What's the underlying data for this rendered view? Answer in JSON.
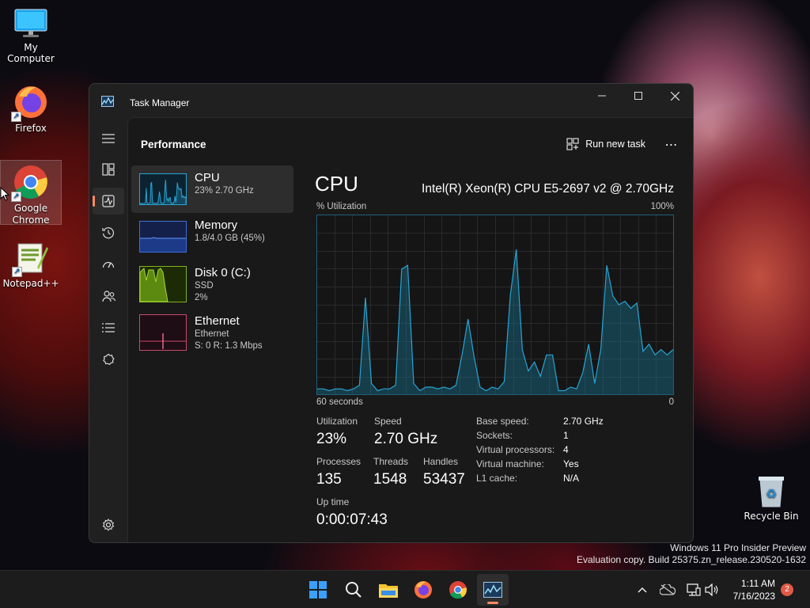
{
  "desktop": {
    "icons": [
      {
        "label": "My Computer"
      },
      {
        "label": "Firefox"
      },
      {
        "label": "Google Chrome"
      },
      {
        "label": "Notepad++"
      },
      {
        "label": "Recycle Bin"
      }
    ],
    "watermark": {
      "line1": "Windows 11 Pro Insider Preview",
      "line2": "Evaluation copy. Build 25375.zn_release.230520-1632"
    }
  },
  "window": {
    "title": "Task Manager",
    "nav_icons": [
      "hamburger-icon",
      "processes-icon",
      "performance-icon",
      "app-history-icon",
      "startup-apps-icon",
      "users-icon",
      "details-icon",
      "services-icon",
      "settings-icon"
    ],
    "page_title": "Performance",
    "run_new_task": "Run new task",
    "more": "⋯"
  },
  "resources": [
    {
      "name": "CPU",
      "sub1": "23%  2.70 GHz",
      "sub2": "",
      "color": "#29a3d1"
    },
    {
      "name": "Memory",
      "sub1": "1.8/4.0 GB (45%)",
      "sub2": "",
      "color": "#3f6fd6"
    },
    {
      "name": "Disk 0 (C:)",
      "sub1": "SSD",
      "sub2": "2%",
      "color": "#7fb31a"
    },
    {
      "name": "Ethernet",
      "sub1": "Ethernet",
      "sub2": "S: 0  R: 1.3 Mbps",
      "color": "#c84a6a"
    }
  ],
  "cpu": {
    "heading": "CPU",
    "model": "Intel(R) Xeon(R) CPU E5-2697 v2 @ 2.70GHz",
    "util_label": "% Utilization",
    "util_max": "100%",
    "time_label": "60 seconds",
    "time_zero": "0",
    "line_color": "#29a3d1",
    "utilization_history": [
      3,
      3,
      2,
      3,
      3,
      2,
      3,
      5,
      54,
      6,
      2,
      3,
      3,
      5,
      70,
      72,
      6,
      2,
      4,
      4,
      3,
      4,
      3,
      5,
      22,
      42,
      21,
      4,
      2,
      4,
      3,
      7,
      55,
      81,
      25,
      13,
      18,
      10,
      22,
      22,
      2,
      2,
      4,
      3,
      12,
      28,
      6,
      25,
      72,
      55,
      50,
      52,
      48,
      51,
      24,
      28,
      22,
      25,
      22,
      25
    ],
    "stats": {
      "utilization": {
        "label": "Utilization",
        "value": "23%"
      },
      "speed": {
        "label": "Speed",
        "value": "2.70 GHz"
      },
      "processes": {
        "label": "Processes",
        "value": "135"
      },
      "threads": {
        "label": "Threads",
        "value": "1548"
      },
      "handles": {
        "label": "Handles",
        "value": "53437"
      },
      "uptime": {
        "label": "Up time",
        "value": "0:00:07:43"
      }
    },
    "details": [
      {
        "k": "Base speed:",
        "v": "2.70 GHz"
      },
      {
        "k": "Sockets:",
        "v": "1"
      },
      {
        "k": "Virtual processors:",
        "v": "4"
      },
      {
        "k": "Virtual machine:",
        "v": "Yes"
      },
      {
        "k": "L1 cache:",
        "v": "N/A"
      }
    ]
  },
  "taskbar": {
    "time": "1:11 AM",
    "date": "7/16/2023",
    "notifications": "2"
  }
}
